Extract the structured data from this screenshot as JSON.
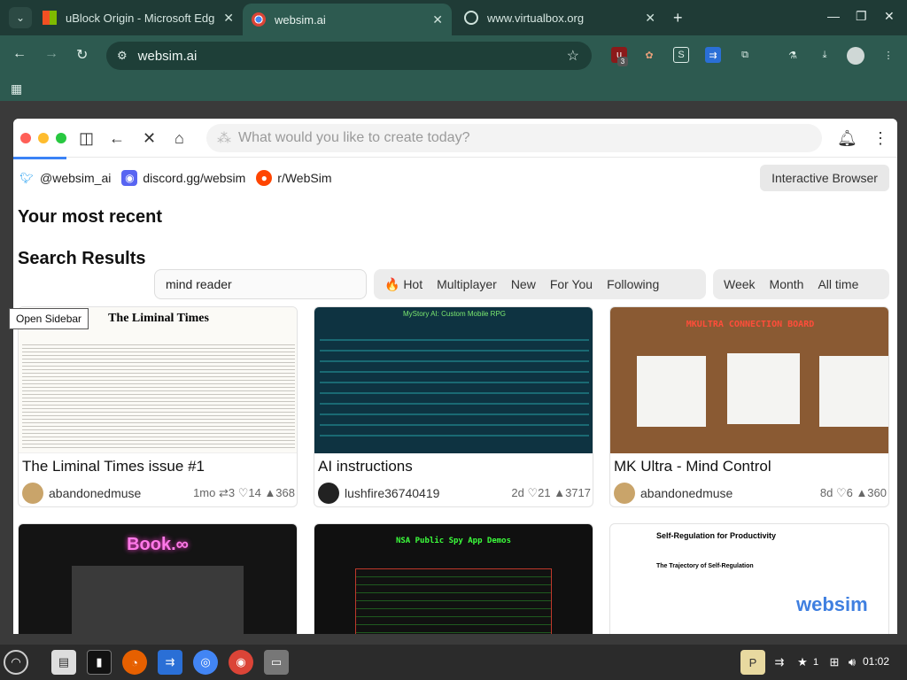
{
  "browser": {
    "tabs": [
      {
        "title": "uBlock Origin - Microsoft Edg",
        "active": false
      },
      {
        "title": "websim.ai",
        "active": true
      },
      {
        "title": "www.virtualbox.org",
        "active": false
      }
    ],
    "url": "websim.ai",
    "extension_badge": "3"
  },
  "websim": {
    "prompt_placeholder": "What would you like to create today?",
    "social": [
      {
        "label": "@websim_ai",
        "icon": "twitter-icon"
      },
      {
        "label": "discord.gg/websim",
        "icon": "discord-icon"
      },
      {
        "label": "r/WebSim",
        "icon": "reddit-icon"
      }
    ],
    "interactive_browser": "Interactive Browser",
    "recent_heading": "Your most recent",
    "results_heading": "Search Results",
    "search_value": "mind reader",
    "sort_tabs": [
      "🔥 Hot",
      "Multiplayer",
      "New",
      "For You",
      "Following"
    ],
    "time_tabs": [
      "Week",
      "Month",
      "All time"
    ],
    "tooltip": "Open Sidebar",
    "cards": [
      {
        "title": "The Liminal Times issue #1",
        "author": "abandonedmuse",
        "stats": "1mo ⇄3 ♡14 ▲368",
        "thumb_title": "The Liminal Times"
      },
      {
        "title": "AI instructions",
        "author": "lushfire36740419",
        "stats": "2d ♡21 ▲3717",
        "thumb_title": "MyStory AI: Custom Mobile RPG"
      },
      {
        "title": "MK Ultra - Mind Control",
        "author": "abandonedmuse",
        "stats": "8d ♡6 ▲360",
        "thumb_title": "MKULTRA CONNECTION BOARD"
      }
    ],
    "row2": [
      {
        "thumb_title": "Book.∞"
      },
      {
        "thumb_title": "NSA Public Spy App Demos"
      },
      {
        "thumb_title": "Self-Regulation for Productivity",
        "thumb_sub": "The Trajectory of Self-Regulation",
        "logo": "websim"
      }
    ]
  },
  "taskbar": {
    "clock": "01:02",
    "tray_num": "1"
  }
}
